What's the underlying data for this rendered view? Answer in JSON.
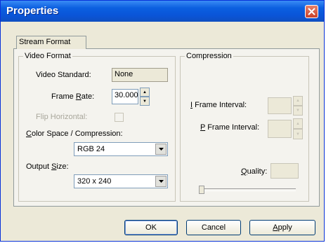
{
  "window": {
    "title": "Properties",
    "close_icon": "close-icon"
  },
  "tabs": [
    {
      "label": "Stream Format",
      "selected": true
    }
  ],
  "video_format": {
    "legend": "Video Format",
    "video_standard_label": "Video Standard:",
    "video_standard_value": "None",
    "frame_rate_label": "Frame Rate:",
    "frame_rate_value": "30.000",
    "flip_horizontal_label": "Flip Horizontal:",
    "color_space_label": "Color Space / Compression:",
    "color_space_value": "RGB 24",
    "output_size_label": "Output Size:",
    "output_size_value": "320 x 240"
  },
  "compression": {
    "legend": "Compression",
    "i_frame_label": "I Frame Interval:",
    "i_frame_value": "",
    "p_frame_label": "P Frame Interval:",
    "p_frame_value": "",
    "quality_label": "Quality:",
    "quality_value": ""
  },
  "buttons": {
    "ok": "OK",
    "cancel": "Cancel",
    "apply": "Apply"
  },
  "colors": {
    "titlebar": "#0b5fe0",
    "dialog": "#ece9d8",
    "close": "#c9412a"
  }
}
